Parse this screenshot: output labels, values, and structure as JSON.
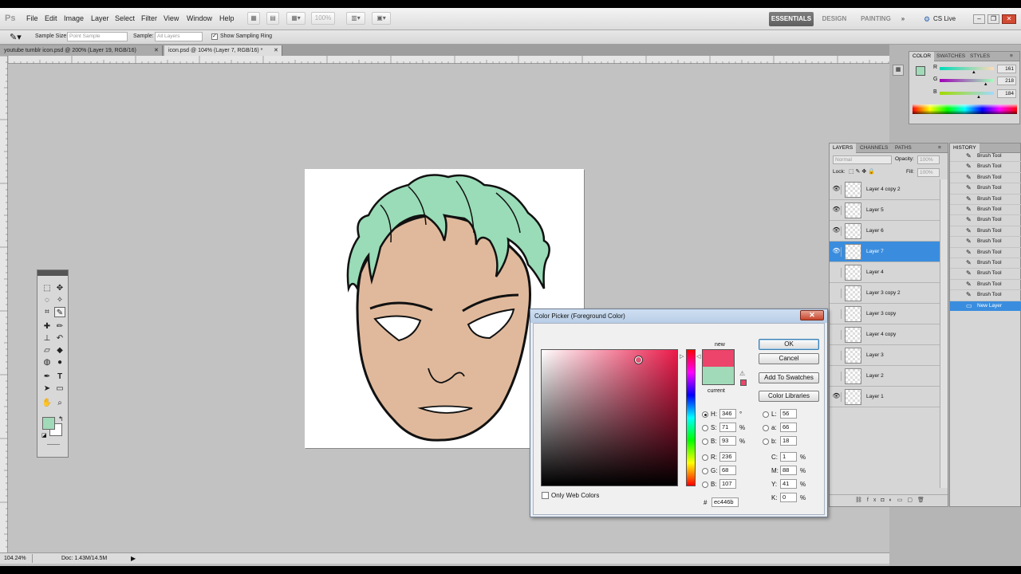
{
  "app": {
    "logo": "Ps"
  },
  "menu": [
    "File",
    "Edit",
    "Image",
    "Layer",
    "Select",
    "Filter",
    "View",
    "Window",
    "Help"
  ],
  "menubar": {
    "zoom": "100%",
    "workspaces": [
      "ESSENTIALS",
      "DESIGN",
      "PAINTING"
    ],
    "more": "»",
    "cs_live": "CS Live"
  },
  "options": {
    "sample_size_label": "Sample Size:",
    "sample_size_value": "Point Sample",
    "sample_label": "Sample:",
    "sample_value": "All Layers",
    "show_ring_label": "Show Sampling Ring"
  },
  "doc_tabs": [
    {
      "label": "youtube tumblr icon.psd @ 200% (Layer 19, RGB/16)",
      "active": false
    },
    {
      "label": "icon.psd @ 104% (Layer 7, RGB/16) *",
      "active": true
    }
  ],
  "status": {
    "zoom": "104.24%",
    "doc": "Doc: 1.43M/14.5M"
  },
  "color_panel": {
    "tabs": [
      "COLOR",
      "SWATCHES",
      "STYLES"
    ],
    "r_label": "R",
    "g_label": "G",
    "b_label": "B",
    "r": "161",
    "g": "218",
    "b": "184",
    "r_frac": 0.63,
    "g_frac": 0.85,
    "b_frac": 0.72
  },
  "layers_panel": {
    "tabs": [
      "LAYERS",
      "CHANNELS",
      "PATHS"
    ],
    "blend_mode": "Normal",
    "opacity_label": "Opacity:",
    "opacity": "100%",
    "lock_label": "Lock:",
    "fill_label": "Fill:",
    "fill": "100%",
    "layers": [
      {
        "name": "Layer 4 copy 2",
        "visible": true,
        "selected": false
      },
      {
        "name": "Layer 5",
        "visible": true,
        "selected": false
      },
      {
        "name": "Layer 6",
        "visible": true,
        "selected": false
      },
      {
        "name": "Layer 7",
        "visible": true,
        "selected": true
      },
      {
        "name": "Layer 4",
        "visible": false,
        "selected": false
      },
      {
        "name": "Layer 3 copy 2",
        "visible": false,
        "selected": false
      },
      {
        "name": "Layer 3 copy",
        "visible": false,
        "selected": false
      },
      {
        "name": "Layer 4 copy",
        "visible": false,
        "selected": false
      },
      {
        "name": "Layer 3",
        "visible": false,
        "selected": false
      },
      {
        "name": "Layer 2",
        "visible": false,
        "selected": false
      },
      {
        "name": "Layer 1",
        "visible": true,
        "selected": false
      }
    ]
  },
  "history_panel": {
    "title": "HISTORY",
    "items": [
      "Brush Tool",
      "Brush Tool",
      "Brush Tool",
      "Brush Tool",
      "Brush Tool",
      "Brush Tool",
      "Brush Tool",
      "Brush Tool",
      "Brush Tool",
      "Brush Tool",
      "Brush Tool",
      "Brush Tool",
      "Brush Tool",
      "Brush Tool",
      "New Layer"
    ]
  },
  "color_picker": {
    "title": "Color Picker (Foreground Color)",
    "ok": "OK",
    "cancel": "Cancel",
    "add_swatches": "Add To Swatches",
    "libraries": "Color Libraries",
    "new_label": "new",
    "current_label": "current",
    "new_color": "#ec446b",
    "current_color": "#a1dab8",
    "hsb": [
      {
        "label": "H:",
        "value": "346",
        "unit": "°"
      },
      {
        "label": "S:",
        "value": "71",
        "unit": "%"
      },
      {
        "label": "B:",
        "value": "93",
        "unit": "%"
      }
    ],
    "rgb": [
      {
        "label": "R:",
        "value": "236"
      },
      {
        "label": "G:",
        "value": "68"
      },
      {
        "label": "B:",
        "value": "107"
      }
    ],
    "lab": [
      {
        "label": "L:",
        "value": "56"
      },
      {
        "label": "a:",
        "value": "66"
      },
      {
        "label": "b:",
        "value": "18"
      }
    ],
    "cmyk": [
      {
        "label": "C:",
        "value": "1",
        "unit": "%"
      },
      {
        "label": "M:",
        "value": "88",
        "unit": "%"
      },
      {
        "label": "Y:",
        "value": "41",
        "unit": "%"
      },
      {
        "label": "K:",
        "value": "0",
        "unit": "%"
      }
    ],
    "hex_label": "#",
    "hex": "ec446b",
    "web_colors": "Only Web Colors",
    "field_hue": "#ec1b4b"
  }
}
